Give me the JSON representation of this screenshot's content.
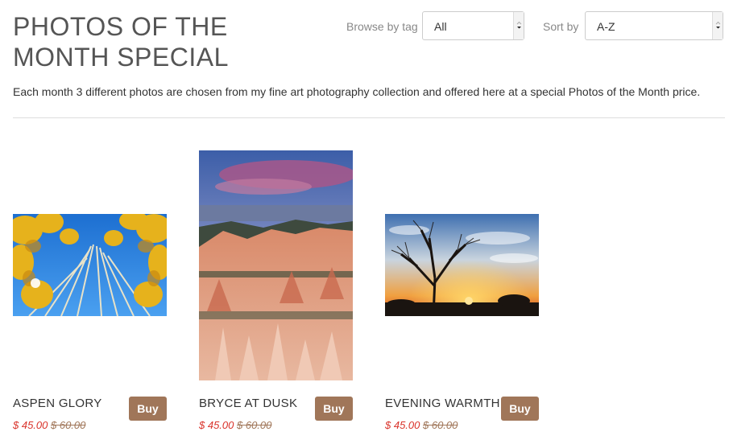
{
  "page": {
    "title": "PHOTOS OF THE MONTH SPECIAL",
    "intro": "Each month 3 different photos are chosen from my fine art photography collection and offered here at a special Photos of the Month price."
  },
  "filters": {
    "browse_label": "Browse by tag",
    "browse_value": "All",
    "sort_label": "Sort by",
    "sort_value": "A-Z"
  },
  "products": [
    {
      "title": "ASPEN GLORY",
      "buy_label": "Buy",
      "sale_price": "$ 45.00",
      "original_price": "$ 60.00",
      "image": "aspen-trees-photo"
    },
    {
      "title": "BRYCE AT DUSK",
      "buy_label": "Buy",
      "sale_price": "$ 45.00",
      "original_price": "$ 60.00",
      "image": "bryce-canyon-photo"
    },
    {
      "title": "EVENING WARMTH",
      "buy_label": "Buy",
      "sale_price": "$ 45.00",
      "original_price": "$ 60.00",
      "image": "sunset-tree-photo"
    }
  ],
  "colors": {
    "buy_button": "#a07659",
    "sale_price": "#d9332b",
    "original_price": "#a07659"
  }
}
